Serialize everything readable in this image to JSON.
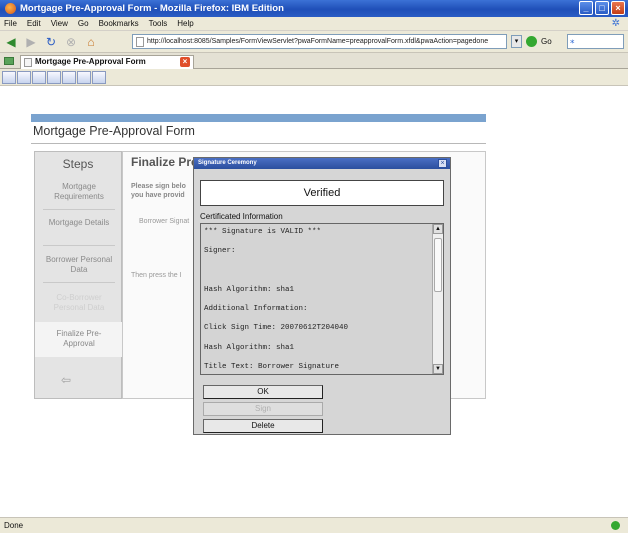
{
  "window": {
    "title": "Mortgage Pre-Approval Form - Mozilla Firefox: IBM Edition"
  },
  "menu": [
    "File",
    "Edit",
    "View",
    "Go",
    "Bookmarks",
    "Tools",
    "Help"
  ],
  "address": {
    "url": "http://localhost:8085/Samples/FormViewServlet?pwaFormName=preapprovalForm.xfdl&pwaAction=pagedone"
  },
  "tab": {
    "label": "Mortgage Pre-Approval Form"
  },
  "form": {
    "title": "Mortgage Pre-Approval Form",
    "steps_heading": "Steps",
    "steps": [
      {
        "label": "Mortgage Requirements"
      },
      {
        "label": "Mortgage Details"
      },
      {
        "label": "Borrower Personal Data"
      },
      {
        "label": "Co-Borrower Personal Data"
      },
      {
        "label": "Finalize Pre-Approval"
      }
    ],
    "back_arrow": "⇦",
    "panel_title": "Finalize Pre",
    "panel_text1": "Please sign belo",
    "panel_text1b": "you have provid",
    "panel_text2": "Borrower Signat",
    "panel_text3": "Then press the I"
  },
  "dialog": {
    "title": "Signature Ceremony",
    "status": "Verified",
    "cert_label": "Certificated Information",
    "cert_lines": [
      "*** Signature is VALID ***",
      "Signer:",
      "",
      "Hash Algorithm:  sha1",
      "Additional Information:",
      "Click Sign Time: 20070612T204040",
      "Hash Algorithm: sha1",
      "Title Text: Borrower Signature"
    ],
    "buttons": {
      "ok": "OK",
      "sign": "Sign",
      "delete": "Delete"
    }
  },
  "status": {
    "text": "Done"
  }
}
